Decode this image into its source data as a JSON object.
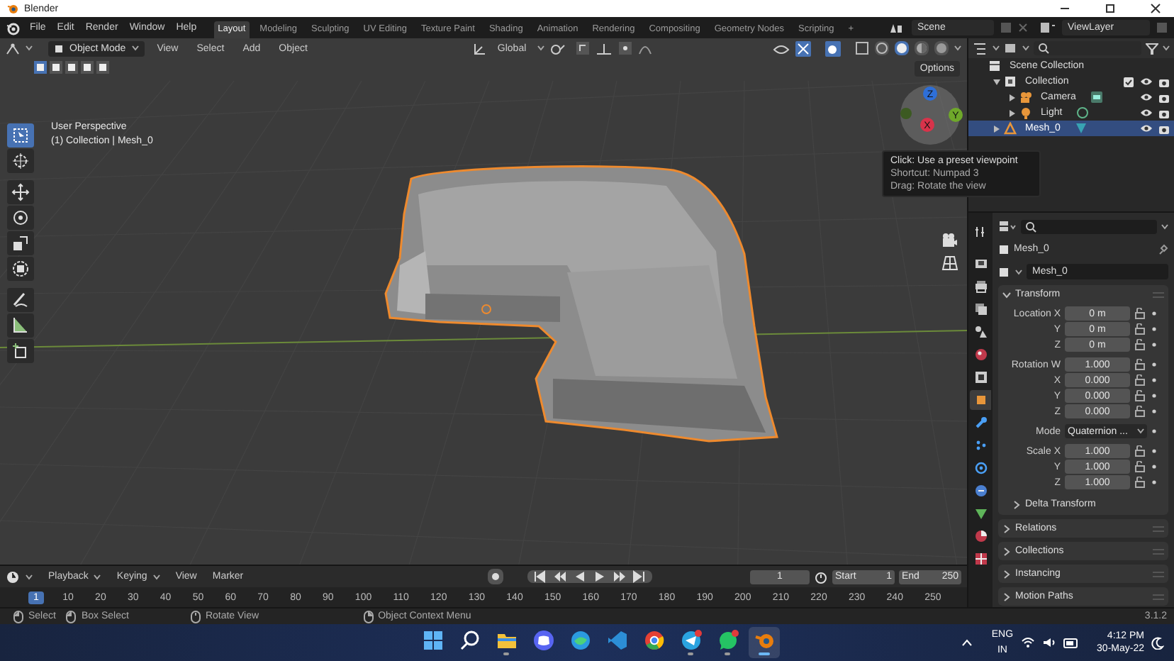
{
  "window": {
    "title": "Blender"
  },
  "menu": [
    "File",
    "Edit",
    "Render",
    "Window",
    "Help"
  ],
  "workspaces": [
    {
      "label": "Layout",
      "selected": true
    },
    {
      "label": "Modeling",
      "selected": false
    },
    {
      "label": "Sculpting",
      "selected": false
    },
    {
      "label": "UV Editing",
      "selected": false
    },
    {
      "label": "Texture Paint",
      "selected": false
    },
    {
      "label": "Shading",
      "selected": false
    },
    {
      "label": "Animation",
      "selected": false
    },
    {
      "label": "Rendering",
      "selected": false
    },
    {
      "label": "Compositing",
      "selected": false
    },
    {
      "label": "Geometry Nodes",
      "selected": false
    },
    {
      "label": "Scripting",
      "selected": false
    }
  ],
  "add_workspace": "+",
  "scene": "Scene",
  "view_layer": "ViewLayer",
  "viewport": {
    "mode": "Object Mode",
    "menus": [
      "View",
      "Select",
      "Add",
      "Object"
    ],
    "orientation": "Global",
    "options": "Options",
    "overlay_text": [
      "User Perspective",
      "(1) Collection | Mesh_0"
    ],
    "tools": [
      {
        "kind": "select",
        "selected": true
      },
      {
        "kind": "cursor",
        "selected": false
      },
      {
        "kind": "move",
        "selected": false
      },
      {
        "kind": "rotate",
        "selected": false
      },
      {
        "kind": "scale",
        "selected": false
      },
      {
        "kind": "transform",
        "selected": false
      },
      {
        "kind": "annotate",
        "selected": false
      },
      {
        "kind": "measure",
        "selected": false
      },
      {
        "kind": "add-cube",
        "selected": false
      }
    ],
    "shading": [
      {
        "kind": "wireframe",
        "selected": false
      },
      {
        "kind": "solid",
        "selected": true
      },
      {
        "kind": "material",
        "selected": false
      },
      {
        "kind": "rendered",
        "selected": false
      }
    ],
    "gizmo": [
      {
        "label": "Z",
        "color": "#2e6fd8"
      },
      {
        "label": "Y",
        "color": "#6fa82a"
      },
      {
        "label": "X",
        "color": "#d8334a"
      }
    ],
    "tooltip": [
      "Click: Use a preset viewpoint",
      "Shortcut: Numpad 3",
      "Drag: Rotate the view"
    ]
  },
  "outliner": {
    "items": [
      {
        "label": "Scene Collection",
        "kind": "scene",
        "selected": false,
        "children": [
          {
            "label": "Collection",
            "kind": "collection",
            "selected": false,
            "expanded": true,
            "checked": true,
            "children": [
              {
                "label": "Camera",
                "kind": "camera",
                "selected": false,
                "expanded": false
              },
              {
                "label": "Light",
                "kind": "light",
                "selected": false,
                "expanded": false
              }
            ]
          },
          {
            "label": "Mesh_0",
            "kind": "mesh",
            "selected": true,
            "expanded": false
          }
        ]
      }
    ]
  },
  "properties": {
    "tabs": [
      {
        "kind": "tool",
        "selected": false
      },
      {
        "kind": "render",
        "selected": false
      },
      {
        "kind": "output",
        "selected": false
      },
      {
        "kind": "view-layer",
        "selected": false
      },
      {
        "kind": "scene",
        "selected": false
      },
      {
        "kind": "world",
        "selected": false
      },
      {
        "kind": "collection",
        "selected": false
      },
      {
        "kind": "object",
        "selected": true
      },
      {
        "kind": "modifier",
        "selected": false
      },
      {
        "kind": "particles",
        "selected": false
      },
      {
        "kind": "physics",
        "selected": false
      },
      {
        "kind": "constraints",
        "selected": false
      },
      {
        "kind": "data",
        "selected": false
      },
      {
        "kind": "material",
        "selected": false
      },
      {
        "kind": "texture",
        "selected": false
      }
    ],
    "object_name": "Mesh_0",
    "data_name": "Mesh_0",
    "transform": {
      "title": "Transform",
      "expanded": true,
      "groups": [
        {
          "rows": [
            {
              "label": "Location X",
              "value": "0 m",
              "kind": "number"
            },
            {
              "label": "Y",
              "value": "0 m",
              "kind": "number"
            },
            {
              "label": "Z",
              "value": "0 m",
              "kind": "number"
            }
          ]
        },
        {
          "rows": [
            {
              "label": "Rotation W",
              "value": "1.000",
              "kind": "number"
            },
            {
              "label": "X",
              "value": "0.000",
              "kind": "number"
            },
            {
              "label": "Y",
              "value": "0.000",
              "kind": "number"
            },
            {
              "label": "Z",
              "value": "0.000",
              "kind": "number"
            }
          ]
        },
        {
          "rows": [
            {
              "label": "Mode",
              "value": "Quaternion ...",
              "kind": "dropdown"
            }
          ]
        },
        {
          "rows": [
            {
              "label": "Scale X",
              "value": "1.000",
              "kind": "number"
            },
            {
              "label": "Y",
              "value": "1.000",
              "kind": "number"
            },
            {
              "label": "Z",
              "value": "1.000",
              "kind": "number"
            }
          ]
        }
      ],
      "subpanels": [
        {
          "title": "Delta Transform",
          "expanded": false
        }
      ]
    },
    "panels": [
      {
        "title": "Relations",
        "expanded": false
      },
      {
        "title": "Collections",
        "expanded": false
      },
      {
        "title": "Instancing",
        "expanded": false
      },
      {
        "title": "Motion Paths",
        "expanded": false
      }
    ]
  },
  "timeline": {
    "menus": [
      "Playback",
      "Keying",
      "View",
      "Marker"
    ],
    "current_frame": "1",
    "start_label": "Start",
    "start": "1",
    "end_label": "End",
    "end": "250",
    "frames": [
      {
        "label": "1",
        "selected": true
      },
      {
        "label": "10",
        "selected": false
      },
      {
        "label": "20",
        "selected": false
      },
      {
        "label": "30",
        "selected": false
      },
      {
        "label": "40",
        "selected": false
      },
      {
        "label": "50",
        "selected": false
      },
      {
        "label": "60",
        "selected": false
      },
      {
        "label": "70",
        "selected": false
      },
      {
        "label": "80",
        "selected": false
      },
      {
        "label": "90",
        "selected": false
      },
      {
        "label": "100",
        "selected": false
      },
      {
        "label": "110",
        "selected": false
      },
      {
        "label": "120",
        "selected": false
      },
      {
        "label": "130",
        "selected": false
      },
      {
        "label": "140",
        "selected": false
      },
      {
        "label": "150",
        "selected": false
      },
      {
        "label": "160",
        "selected": false
      },
      {
        "label": "170",
        "selected": false
      },
      {
        "label": "180",
        "selected": false
      },
      {
        "label": "190",
        "selected": false
      },
      {
        "label": "200",
        "selected": false
      },
      {
        "label": "210",
        "selected": false
      },
      {
        "label": "220",
        "selected": false
      },
      {
        "label": "230",
        "selected": false
      },
      {
        "label": "240",
        "selected": false
      },
      {
        "label": "250",
        "selected": false
      }
    ]
  },
  "status_bar": {
    "hints": [
      {
        "label": "Select",
        "kind": "left"
      },
      {
        "label": "Box Select",
        "kind": "left-drag"
      },
      {
        "label": "Rotate View",
        "kind": "middle"
      },
      {
        "label": "Object Context Menu",
        "kind": "right"
      }
    ],
    "version": "3.1.2"
  },
  "taskbar": {
    "apps": [
      {
        "kind": "start",
        "running": false,
        "selected": false
      },
      {
        "kind": "search",
        "running": false,
        "selected": false
      },
      {
        "kind": "files",
        "running": true,
        "selected": false
      },
      {
        "kind": "discord",
        "running": false,
        "selected": false
      },
      {
        "kind": "edge",
        "running": false,
        "selected": false
      },
      {
        "kind": "vscode",
        "running": false,
        "selected": false
      },
      {
        "kind": "chrome",
        "running": false,
        "selected": false
      },
      {
        "kind": "telegram",
        "running": true,
        "selected": false
      },
      {
        "kind": "whatsapp",
        "running": true,
        "selected": false
      },
      {
        "kind": "blender",
        "running": true,
        "selected": true
      }
    ],
    "language": "ENG",
    "region": "IN",
    "time": "4:12 PM",
    "date": "30-May-22"
  }
}
